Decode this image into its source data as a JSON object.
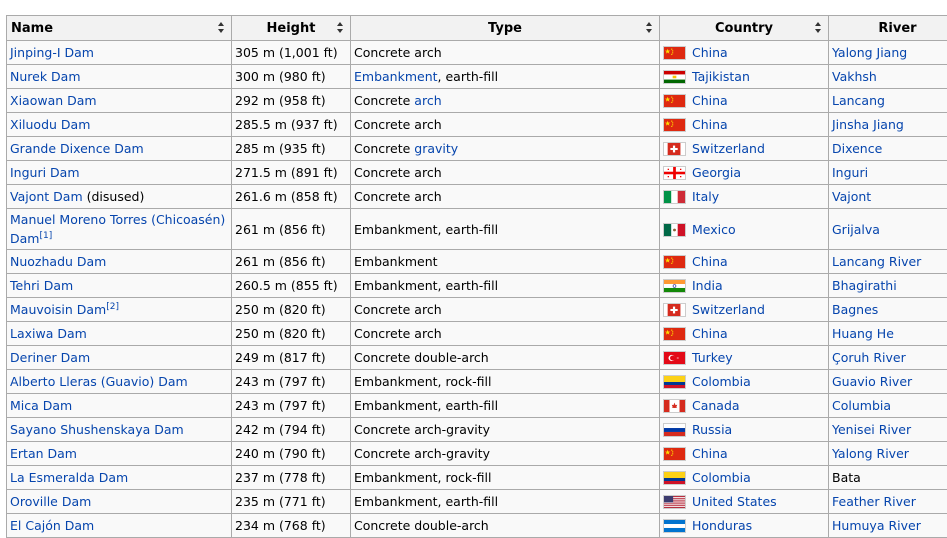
{
  "columns": [
    "Name",
    "Height",
    "Type",
    "Country",
    "River"
  ],
  "rows": [
    {
      "name": "Jinping-I Dam",
      "name_link": true,
      "height": "305 m (1,001 ft)",
      "type_pre": "Concrete arch",
      "type_link": "",
      "type_post": "",
      "country": "China",
      "flag": "china-flag-icon",
      "river": "Yalong Jiang",
      "river_link": true
    },
    {
      "name": "Nurek Dam",
      "name_link": true,
      "height": "300 m (980 ft)",
      "type_pre": "",
      "type_link": "Embankment",
      "type_post": ", earth-fill",
      "country": "Tajikistan",
      "flag": "tajikistan-flag-icon",
      "river": "Vakhsh",
      "river_link": true
    },
    {
      "name": "Xiaowan Dam",
      "name_link": true,
      "height": "292 m (958 ft)",
      "type_pre": "Concrete ",
      "type_link": "arch",
      "type_post": "",
      "country": "China",
      "flag": "china-flag-icon",
      "river": "Lancang",
      "river_link": true
    },
    {
      "name": "Xiluodu Dam",
      "name_link": true,
      "height": "285.5 m (937 ft)",
      "type_pre": "Concrete arch",
      "type_link": "",
      "type_post": "",
      "country": "China",
      "flag": "china-flag-icon",
      "river": "Jinsha Jiang",
      "river_link": true
    },
    {
      "name": "Grande Dixence Dam",
      "name_link": true,
      "height": "285 m (935 ft)",
      "type_pre": "Concrete ",
      "type_link": "gravity",
      "type_post": "",
      "country": "Switzerland",
      "flag": "switzerland-flag-icon",
      "river": "Dixence",
      "river_link": true
    },
    {
      "name": "Inguri Dam",
      "name_link": true,
      "height": "271.5 m (891 ft)",
      "type_pre": "Concrete arch",
      "type_link": "",
      "type_post": "",
      "country": "Georgia",
      "flag": "georgia-flag-icon",
      "river": "Inguri",
      "river_link": true
    },
    {
      "name": "Vajont Dam",
      "name_suffix": " (disused)",
      "name_link": true,
      "height": "261.6 m (858 ft)",
      "type_pre": "Concrete arch",
      "type_link": "",
      "type_post": "",
      "country": "Italy",
      "flag": "italy-flag-icon",
      "river": "Vajont",
      "river_link": true
    },
    {
      "name": "Manuel Moreno Torres (Chicoasén) Dam",
      "name_sup": "[1]",
      "name_link": true,
      "height": "261 m (856 ft)",
      "type_pre": "Embankment, earth-fill",
      "type_link": "",
      "type_post": "",
      "country": "Mexico",
      "flag": "mexico-flag-icon",
      "river": "Grijalva",
      "river_link": true
    },
    {
      "name": "Nuozhadu Dam",
      "name_link": true,
      "height": "261 m (856 ft)",
      "type_pre": "Embankment",
      "type_link": "",
      "type_post": "",
      "country": "China",
      "flag": "china-flag-icon",
      "river": "Lancang River",
      "river_link": true
    },
    {
      "name": "Tehri Dam",
      "name_link": true,
      "height": "260.5 m (855 ft)",
      "type_pre": "Embankment, earth-fill",
      "type_link": "",
      "type_post": "",
      "country": "India",
      "flag": "india-flag-icon",
      "river": "Bhagirathi",
      "river_link": true
    },
    {
      "name": "Mauvoisin Dam",
      "name_sup": "[2]",
      "name_link": true,
      "height": "250 m (820 ft)",
      "type_pre": "Concrete arch",
      "type_link": "",
      "type_post": "",
      "country": "Switzerland",
      "flag": "switzerland-flag-icon",
      "river": "Bagnes",
      "river_link": true
    },
    {
      "name": "Laxiwa Dam",
      "name_link": true,
      "height": "250 m (820 ft)",
      "type_pre": "Concrete arch",
      "type_link": "",
      "type_post": "",
      "country": "China",
      "flag": "china-flag-icon",
      "river": "Huang He",
      "river_link": true
    },
    {
      "name": "Deriner Dam",
      "name_link": true,
      "height": "249 m (817 ft)",
      "type_pre": "Concrete double-arch",
      "type_link": "",
      "type_post": "",
      "country": "Turkey",
      "flag": "turkey-flag-icon",
      "river": "Çoruh River",
      "river_link": true
    },
    {
      "name": "Alberto Lleras (Guavio) Dam",
      "name_link": true,
      "height": "243 m (797 ft)",
      "type_pre": "Embankment, rock-fill",
      "type_link": "",
      "type_post": "",
      "country": "Colombia",
      "flag": "colombia-flag-icon",
      "river": "Guavio River",
      "river_link": true
    },
    {
      "name": "Mica Dam",
      "name_link": true,
      "height": "243 m (797 ft)",
      "type_pre": "Embankment, earth-fill",
      "type_link": "",
      "type_post": "",
      "country": "Canada",
      "flag": "canada-flag-icon",
      "river": "Columbia",
      "river_link": true
    },
    {
      "name": "Sayano Shushenskaya Dam",
      "name_link": true,
      "height": "242 m (794 ft)",
      "type_pre": "Concrete arch-gravity",
      "type_link": "",
      "type_post": "",
      "country": "Russia",
      "flag": "russia-flag-icon",
      "river": "Yenisei River",
      "river_link": true
    },
    {
      "name": "Ertan Dam",
      "name_link": true,
      "height": "240 m (790 ft)",
      "type_pre": "Concrete arch-gravity",
      "type_link": "",
      "type_post": "",
      "country": "China",
      "flag": "china-flag-icon",
      "river": "Yalong River",
      "river_link": true
    },
    {
      "name": "La Esmeralda Dam",
      "name_link": true,
      "height": "237 m (778 ft)",
      "type_pre": "Embankment, rock-fill",
      "type_link": "",
      "type_post": "",
      "country": "Colombia",
      "flag": "colombia-flag-icon",
      "river": "Bata",
      "river_link": false
    },
    {
      "name": "Oroville Dam",
      "name_link": true,
      "height": "235 m (771 ft)",
      "type_pre": "Embankment, earth-fill",
      "type_link": "",
      "type_post": "",
      "country": "United States",
      "flag": "usa-flag-icon",
      "river": "Feather River",
      "river_link": true
    },
    {
      "name": "El Cajón Dam",
      "name_link": true,
      "height": "234 m (768 ft)",
      "type_pre": "Concrete double-arch",
      "type_link": "",
      "type_post": "",
      "country": "Honduras",
      "flag": "honduras-flag-icon",
      "river": "Humuya River",
      "river_link": true
    }
  ]
}
